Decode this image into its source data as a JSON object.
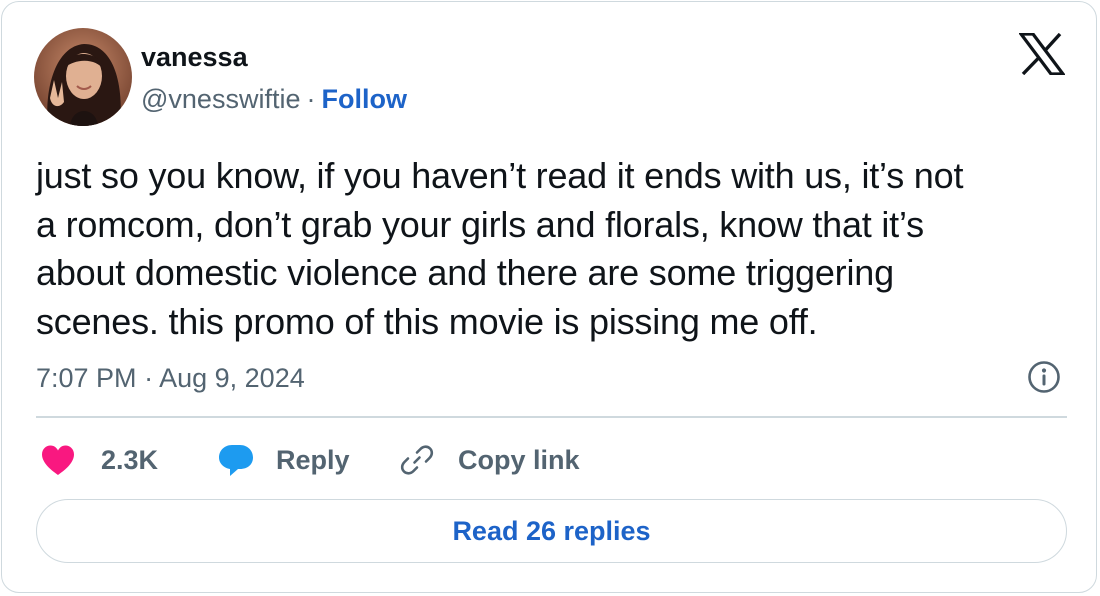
{
  "author": {
    "display_name": "vanessa",
    "handle": "@vnesswiftie",
    "separator": "·",
    "follow_label": "Follow",
    "avatar_icon": "user-avatar-photo"
  },
  "brand": {
    "logo_icon": "x-logo-icon"
  },
  "tweet": {
    "text_lines": [
      "just so you know, if you haven’t read it ends with us, it’s not",
      "a romcom, don’t grab your girls and florals, know that it’s",
      "about domestic violence and there are some triggering",
      "scenes. this promo of this movie is pissing me off."
    ],
    "time": "7:07 PM",
    "date_separator": "·",
    "date": "Aug 9, 2024",
    "info_icon": "info-icon"
  },
  "actions": {
    "like_count": "2.3K",
    "like_icon": "heart-icon",
    "reply_label": "Reply",
    "reply_icon": "speech-bubble-icon",
    "copy_label": "Copy link",
    "copy_icon": "link-icon"
  },
  "footer": {
    "read_replies_label": "Read 26 replies"
  },
  "colors": {
    "link_blue": "#1d63c8",
    "heart_pink": "#f91880",
    "reply_blue": "#1d9bf0",
    "secondary_text": "#536471",
    "border": "#cfd9de"
  }
}
